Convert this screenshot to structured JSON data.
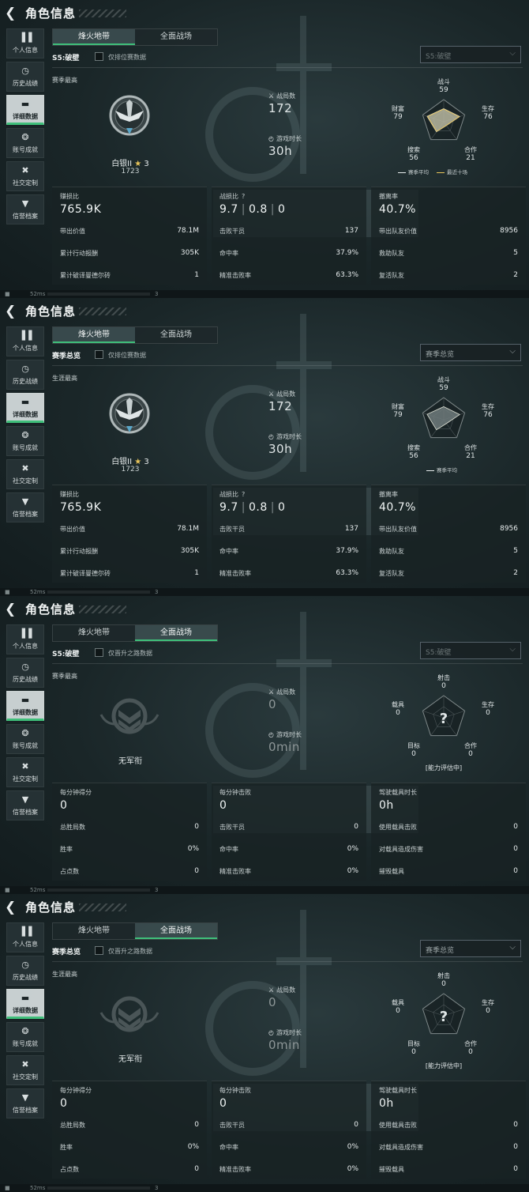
{
  "screens": [
    {
      "title": "角色信息",
      "sidebar": [
        "个人信息",
        "历史战绩",
        "详细数据",
        "账号成就",
        "社交定制",
        "信誉档案"
      ],
      "tabs": [
        "烽火地带",
        "全面战场"
      ],
      "season_label": "S5:破壁",
      "checkbox_label": "仅排位赛数据",
      "dropdown_value": "S5:破壁",
      "best_label": "赛季最高",
      "rank_name": "白银II",
      "rank_stars": "3",
      "rank_score": "1723",
      "matches_label": "战局数",
      "matches_value": "172",
      "playtime_label": "游戏时长",
      "playtime_value": "30h",
      "radar": {
        "top_label": "战斗",
        "top_value": "59",
        "left_label": "财富",
        "left_value": "79",
        "right_label": "生存",
        "right_value": "76",
        "bl_label": "搜索",
        "bl_value": "56",
        "br_label": "合作",
        "br_value": "21"
      },
      "legend": [
        "赛季平均",
        "最近十场"
      ],
      "cards": [
        {
          "title": "赚损比",
          "value": "765.9K",
          "rows": [
            [
              "带出价值",
              "78.1M"
            ],
            [
              "累计行动报酬",
              "305K"
            ],
            [
              "累计破译曼德尔砖",
              "1"
            ]
          ]
        },
        {
          "title": "战损比",
          "value_a": "9.7",
          "value_b": "0.8",
          "value_c": "0",
          "q": "?",
          "rows": [
            [
              "击败干员",
              "137"
            ],
            [
              "命中率",
              "37.9%"
            ],
            [
              "精准击败率",
              "63.3%"
            ]
          ]
        },
        {
          "title": "撤离率",
          "value": "40.7%",
          "rows": [
            [
              "带出队友价值",
              "8956"
            ],
            [
              "救助队友",
              "5"
            ],
            [
              "复活队友",
              "2"
            ]
          ]
        }
      ],
      "status": {
        "ping": "52ms",
        "num": "3"
      }
    },
    {
      "title": "角色信息",
      "sidebar": [
        "个人信息",
        "历史战绩",
        "详细数据",
        "账号成就",
        "社交定制",
        "信誉档案"
      ],
      "tabs": [
        "烽火地带",
        "全面战场"
      ],
      "season_label": "赛季总览",
      "checkbox_label": "仅排位赛数据",
      "dropdown_value": "赛季总览",
      "best_label": "生涯最高",
      "rank_name": "白银II",
      "rank_stars": "3",
      "rank_score": "1723",
      "matches_label": "战局数",
      "matches_value": "172",
      "playtime_label": "游戏时长",
      "playtime_value": "30h",
      "radar": {
        "top_label": "战斗",
        "top_value": "59",
        "left_label": "财富",
        "left_value": "79",
        "right_label": "生存",
        "right_value": "76",
        "bl_label": "搜索",
        "bl_value": "56",
        "br_label": "合作",
        "br_value": "21"
      },
      "legend": [
        "赛季平均"
      ],
      "cards": [
        {
          "title": "赚损比",
          "value": "765.9K",
          "rows": [
            [
              "带出价值",
              "78.1M"
            ],
            [
              "累计行动报酬",
              "305K"
            ],
            [
              "累计破译曼德尔砖",
              "1"
            ]
          ]
        },
        {
          "title": "战损比",
          "value_a": "9.7",
          "value_b": "0.8",
          "value_c": "0",
          "q": "?",
          "rows": [
            [
              "击败干员",
              "137"
            ],
            [
              "命中率",
              "37.9%"
            ],
            [
              "精准击败率",
              "63.3%"
            ]
          ]
        },
        {
          "title": "撤离率",
          "value": "40.7%",
          "rows": [
            [
              "带出队友价值",
              "8956"
            ],
            [
              "救助队友",
              "5"
            ],
            [
              "复活队友",
              "2"
            ]
          ]
        }
      ],
      "status": {
        "ping": "52ms",
        "num": "3"
      }
    },
    {
      "title": "角色信息",
      "sidebar": [
        "个人信息",
        "历史战绩",
        "详细数据",
        "账号成就",
        "社交定制",
        "信誉档案"
      ],
      "tabs": [
        "烽火地带",
        "全面战场"
      ],
      "season_label": "S5:破壁",
      "checkbox_label": "仅晋升之路数据",
      "dropdown_value": "S5:破壁",
      "best_label": "赛季最高",
      "rank_none": "无军衔",
      "matches_label": "战局数",
      "matches_value": "0",
      "playtime_label": "游戏时长",
      "playtime_value": "0min",
      "radar": {
        "top_label": "射击",
        "top_value": "0",
        "left_label": "载具",
        "left_value": "0",
        "right_label": "生存",
        "right_value": "0",
        "bl_label": "目标",
        "bl_value": "0",
        "br_label": "合作",
        "br_value": "0",
        "center": "?",
        "note": "[能力评估中]"
      },
      "cards": [
        {
          "title": "每分钟得分",
          "value": "0",
          "rows": [
            [
              "总胜局数",
              "0"
            ],
            [
              "胜率",
              "0%"
            ],
            [
              "占点数",
              "0"
            ]
          ]
        },
        {
          "title": "每分钟击败",
          "value": "0",
          "rows": [
            [
              "击败干员",
              "0"
            ],
            [
              "命中率",
              "0%"
            ],
            [
              "精准击败率",
              "0%"
            ]
          ]
        },
        {
          "title": "驾驶载具时长",
          "value": "0h",
          "rows": [
            [
              "使用载具击败",
              "0"
            ],
            [
              "对载具造成伤害",
              "0"
            ],
            [
              "摧毁载具",
              "0"
            ]
          ]
        }
      ],
      "status": {
        "ping": "52ms",
        "num": "3"
      }
    },
    {
      "title": "角色信息",
      "sidebar": [
        "个人信息",
        "历史战绩",
        "详细数据",
        "账号成就",
        "社交定制",
        "信誉档案"
      ],
      "tabs": [
        "烽火地带",
        "全面战场"
      ],
      "season_label": "赛季总览",
      "checkbox_label": "仅晋升之路数据",
      "dropdown_value": "赛季总览",
      "best_label": "生涯最高",
      "rank_none": "无军衔",
      "matches_label": "战局数",
      "matches_value": "0",
      "playtime_label": "游戏时长",
      "playtime_value": "0min",
      "radar": {
        "top_label": "射击",
        "top_value": "0",
        "left_label": "载具",
        "left_value": "0",
        "right_label": "生存",
        "right_value": "0",
        "bl_label": "目标",
        "bl_value": "0",
        "br_label": "合作",
        "br_value": "0",
        "center": "?",
        "note": "[能力评估中]"
      },
      "cards": [
        {
          "title": "每分钟得分",
          "value": "0",
          "rows": [
            [
              "总胜局数",
              "0"
            ],
            [
              "胜率",
              "0%"
            ],
            [
              "占点数",
              "0"
            ]
          ]
        },
        {
          "title": "每分钟击败",
          "value": "0",
          "rows": [
            [
              "击败干员",
              "0"
            ],
            [
              "命中率",
              "0%"
            ],
            [
              "精准击败率",
              "0%"
            ]
          ]
        },
        {
          "title": "驾驶载具时长",
          "value": "0h",
          "rows": [
            [
              "使用载具击败",
              "0"
            ],
            [
              "对载具造成伤害",
              "0"
            ],
            [
              "摧毁载具",
              "0"
            ]
          ]
        }
      ],
      "status": {
        "ping": "52ms",
        "num": "3"
      }
    }
  ],
  "colors": {
    "accent": "#3fbf7a",
    "gold": "#e8c45a",
    "radar_fill": "#b9b7a0"
  }
}
